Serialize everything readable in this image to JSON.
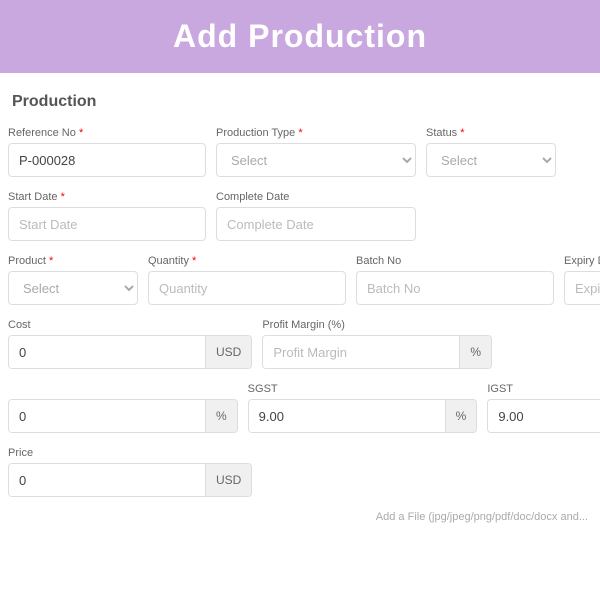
{
  "header": {
    "title": "Add Production"
  },
  "section": {
    "title": "Production"
  },
  "fields": {
    "reference_no": {
      "label": "Reference No",
      "required": true,
      "value": "P-000028",
      "placeholder": "P-000028"
    },
    "production_type": {
      "label": "Production Type",
      "required": true,
      "placeholder": "Select",
      "options": [
        "Select"
      ]
    },
    "status": {
      "label": "Status",
      "required": true,
      "placeholder": "Select",
      "options": [
        "Select"
      ]
    },
    "start_date": {
      "label": "Start Date",
      "required": true,
      "placeholder": "Start Date"
    },
    "complete_date": {
      "label": "Complete Date",
      "placeholder": "Complete Date"
    },
    "product": {
      "label": "Product",
      "required": true,
      "placeholder": "Select",
      "options": [
        "Select"
      ]
    },
    "quantity": {
      "label": "Quantity",
      "required": true,
      "placeholder": "Quantity"
    },
    "batch_no": {
      "label": "Batch No",
      "placeholder": "Batch No",
      "value": ""
    },
    "expiry_date": {
      "label": "Expiry Date",
      "placeholder": "Expiry"
    },
    "cost": {
      "label": "Cost",
      "value": "0",
      "addon": "USD"
    },
    "profit_margin": {
      "label": "Profit Margin (%)",
      "placeholder": "Profit Margin",
      "addon": "%"
    },
    "row3_left": {
      "label": "",
      "value": "0",
      "addon": "%"
    },
    "sgst": {
      "label": "SGST",
      "value": "9.00",
      "addon": "%"
    },
    "igst": {
      "label": "IGST",
      "value": "9.00",
      "addon": "%"
    },
    "price": {
      "label": "Price",
      "value": "0",
      "addon": "USD"
    },
    "file_hint": "Add a File (jpg/jpeg/png/pdf/doc/docx and..."
  }
}
